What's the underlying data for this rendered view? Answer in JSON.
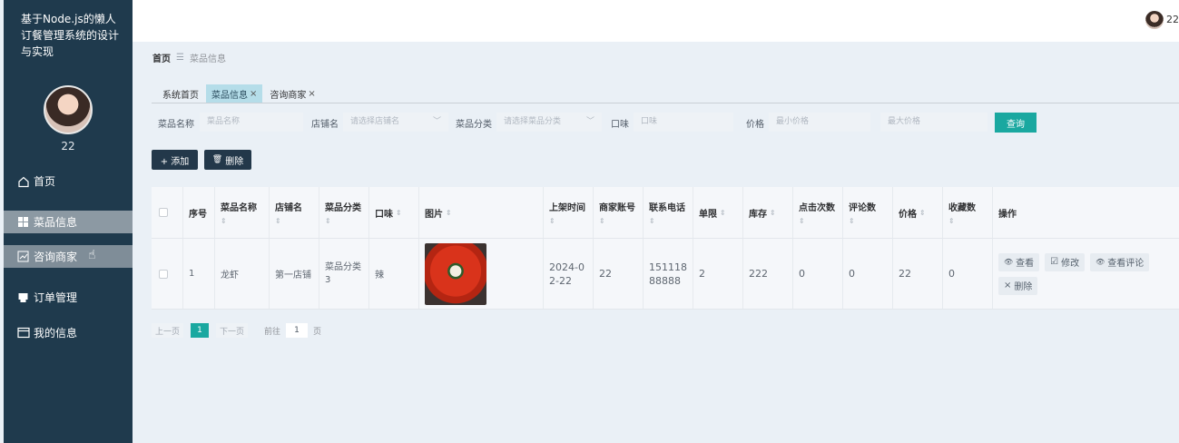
{
  "sidebar": {
    "system_title": "基于Node.js的懒人订餐管理系统的设计与实现",
    "username": "22",
    "menu": [
      {
        "label": "首页",
        "icon": "home-icon"
      },
      {
        "label": "菜品信息",
        "icon": "grid-icon"
      },
      {
        "label": "咨询商家",
        "icon": "chart-icon"
      },
      {
        "label": "订单管理",
        "icon": "printer-icon"
      },
      {
        "label": "我的信息",
        "icon": "card-icon"
      }
    ]
  },
  "topbar": {
    "username": "22"
  },
  "breadcrumb": {
    "home": "首页",
    "separator": "☰",
    "current": "菜品信息"
  },
  "tabs": [
    {
      "label": "系统首页",
      "closable": false
    },
    {
      "label": "菜品信息",
      "closable": true
    },
    {
      "label": "咨询商家",
      "closable": true
    }
  ],
  "search": {
    "dish_name_label": "菜品名称",
    "dish_name_placeholder": "菜品名称",
    "shop_label": "店铺名",
    "shop_placeholder": "请选择店铺名",
    "category_label": "菜品分类",
    "category_placeholder": "请选择菜品分类",
    "taste_label": "口味",
    "taste_placeholder": "口味",
    "price_label": "价格",
    "min_price_placeholder": "最小价格",
    "max_price_placeholder": "最大价格",
    "query_button": "查询"
  },
  "actions": {
    "add": "+ 添加",
    "delete": "删除"
  },
  "table": {
    "headers": {
      "index": "序号",
      "name": "菜品名称",
      "shop": "店铺名",
      "category": "菜品分类",
      "taste": "口味",
      "image": "图片",
      "time": "上架时间",
      "account": "商家账号",
      "phone": "联系电话",
      "limit": "单限",
      "stock": "库存",
      "clicks": "点击次数",
      "reviews": "评论数",
      "price": "价格",
      "favorites": "收藏数",
      "ops": "操作"
    },
    "rows": [
      {
        "index": "1",
        "name": "龙虾",
        "shop": "第一店铺",
        "category": "菜品分类3",
        "taste": "辣",
        "time": "2024-02-22",
        "account": "22",
        "phone": "15111888888",
        "limit": "2",
        "stock": "222",
        "clicks": "0",
        "reviews": "0",
        "price": "22",
        "favorites": "0"
      }
    ],
    "ops": {
      "view": "查看",
      "edit": "修改",
      "view_reviews": "查看评论",
      "delete": "删除"
    }
  },
  "pager": {
    "prev": "上一页",
    "current": "1",
    "next": "下一页",
    "goto": "前往",
    "goto_value": "1",
    "page": "页"
  }
}
